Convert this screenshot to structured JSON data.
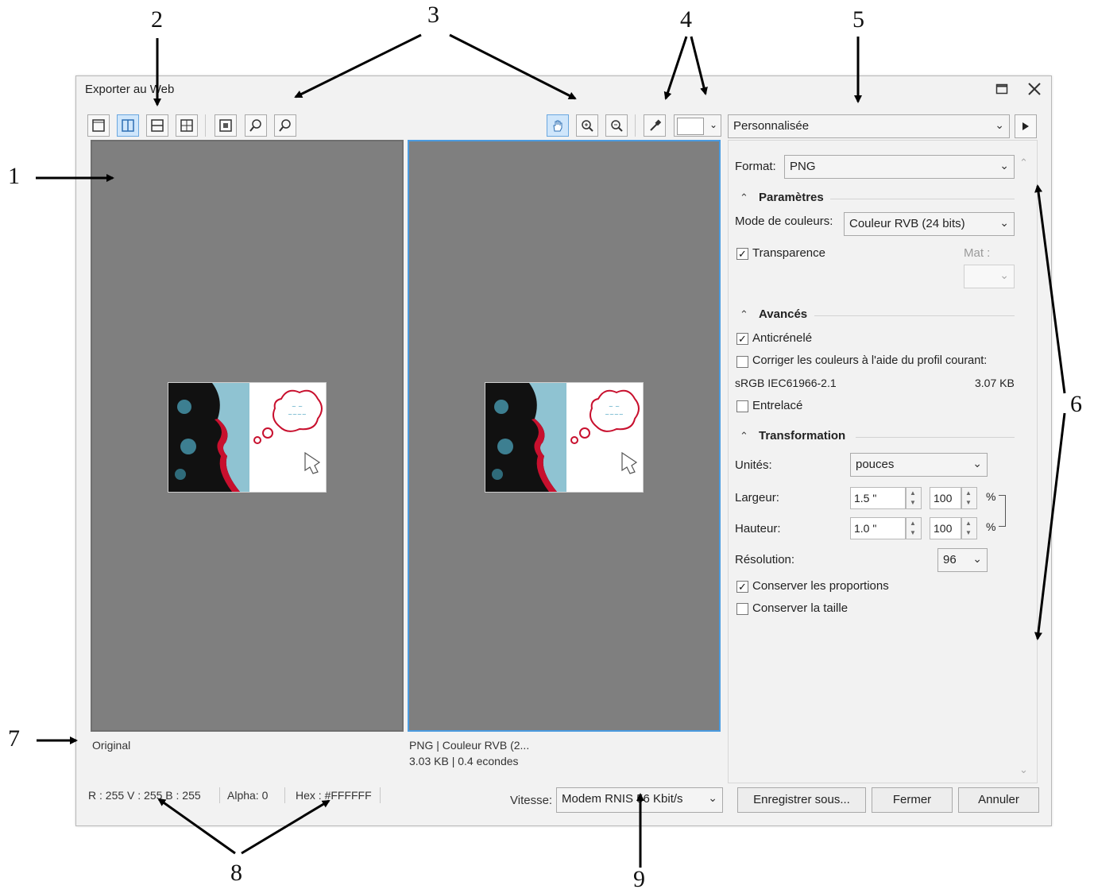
{
  "window": {
    "title": "Exporter au Web"
  },
  "callouts": [
    "1",
    "2",
    "3",
    "4",
    "5",
    "6",
    "7",
    "8",
    "9"
  ],
  "preview": {
    "left_caption": "Original",
    "right_line1": "PNG  |  Couleur RVB (2...",
    "right_line2": "3.03 KB  |  0.4 econdes"
  },
  "toolbar_right": {
    "preset": "Personnalisée"
  },
  "panel": {
    "format_label": "Format:",
    "format_value": "PNG",
    "params_title": "Paramètres",
    "color_mode_label": "Mode de couleurs:",
    "color_mode_value": "Couleur RVB (24 bits)",
    "transparency_label": "Transparence",
    "transparency_checked": true,
    "mat_label": "Mat :",
    "advanced_title": "Avancés",
    "antialias_label": "Anticrénelé",
    "antialias_checked": true,
    "correct_colors_label": "Corriger les couleurs à l'aide du profil courant:",
    "correct_colors_checked": false,
    "profile_name": "sRGB IEC61966-2.1",
    "file_size": "3.07 KB",
    "interlaced_label": "Entrelacé",
    "interlaced_checked": false,
    "transform_title": "Transformation",
    "units_label": "Unités:",
    "units_value": "pouces",
    "width_label": "Largeur:",
    "width_value": "1.5 \"",
    "width_percent": "100",
    "height_label": "Hauteur:",
    "height_value": "1.0 \"",
    "height_percent": "100",
    "percent_sign": "%",
    "resolution_label": "Résolution:",
    "resolution_value": "96",
    "keep_proportions_label": "Conserver les proportions",
    "keep_proportions_checked": true,
    "keep_size_label": "Conserver la taille",
    "keep_size_checked": false
  },
  "status": {
    "rgb": "R : 255   V : 255   B : 255",
    "alpha": "Alpha: 0",
    "hex": "Hex : #FFFFFF"
  },
  "speed": {
    "label": "Vitesse:",
    "value": "Modem RNIS 56 Kbit/s"
  },
  "buttons": {
    "save_as": "Enregistrer sous...",
    "close": "Fermer",
    "cancel": "Annuler"
  },
  "icons": [
    "window-maximize-icon",
    "window-close-icon",
    "single-view-icon",
    "split-vertical-icon",
    "split-horizontal-icon",
    "quad-view-icon",
    "fit-to-window-icon",
    "zoom-one-to-one-icon",
    "zoom-100-icon",
    "pan-hand-icon",
    "zoom-in-icon",
    "zoom-out-icon",
    "eyedropper-icon",
    "color-swatch-icon",
    "presets-menu-arrow-icon"
  ]
}
